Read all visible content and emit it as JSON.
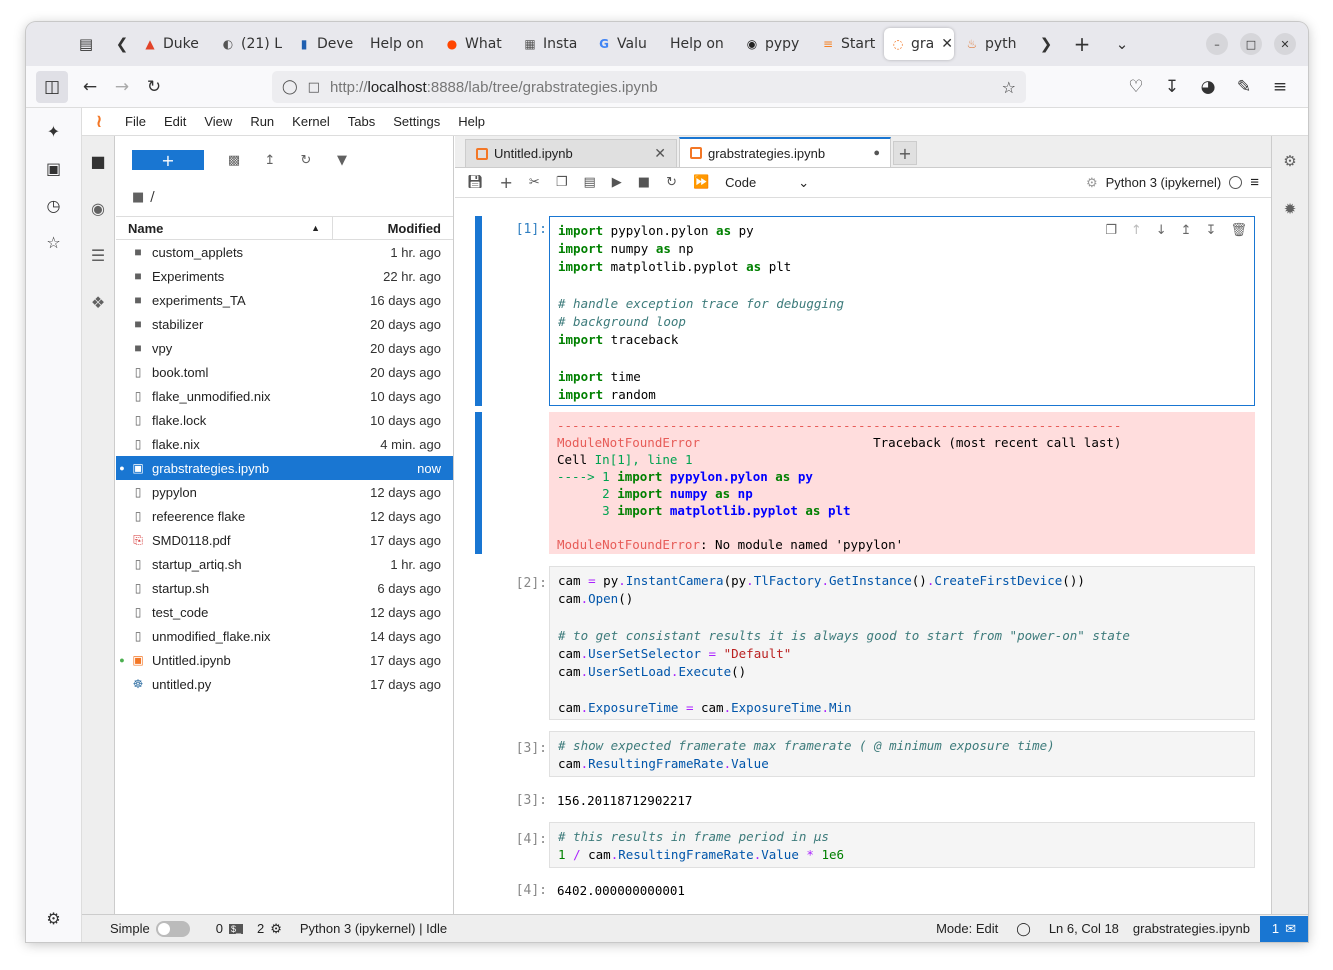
{
  "browser": {
    "tabs": [
      {
        "label": "Duke",
        "icon": "gitlab-icon",
        "color": "#e24329"
      },
      {
        "label": "(21) L",
        "icon": "chat-icon",
        "color": "#555555"
      },
      {
        "label": "Deve",
        "icon": "dev-icon",
        "color": "#1f5fb0"
      },
      {
        "label": "Help on",
        "icon": "",
        "color": ""
      },
      {
        "label": "What",
        "icon": "reddit-icon",
        "color": "#ff4500"
      },
      {
        "label": "Insta",
        "icon": "grid-icon",
        "color": "#555555"
      },
      {
        "label": "Valu",
        "icon": "google-icon",
        "color": "#4285f4"
      },
      {
        "label": "Help on",
        "icon": "",
        "color": ""
      },
      {
        "label": "pypy",
        "icon": "github-icon",
        "color": "#222222"
      },
      {
        "label": "Start",
        "icon": "stack-icon",
        "color": "#f48024"
      },
      {
        "label": "gra",
        "icon": "jupyter-icon",
        "color": "#f37726",
        "active": true
      },
      {
        "label": "pyth",
        "icon": "python-icon",
        "color": "#e07b39"
      }
    ],
    "url_prefix": "http://",
    "url_host": "localhost",
    "url_rest": ":8888/lab/tree/grabstrategies.ipynb"
  },
  "menu": [
    "File",
    "Edit",
    "View",
    "Run",
    "Kernel",
    "Tabs",
    "Settings",
    "Help"
  ],
  "filebrowser": {
    "new_label": "+",
    "path": "/",
    "col_name": "Name",
    "col_modified": "Modified",
    "files": [
      {
        "name": "custom_applets",
        "modified": "1 hr. ago",
        "type": "folder"
      },
      {
        "name": "Experiments",
        "modified": "22 hr. ago",
        "type": "folder"
      },
      {
        "name": "experiments_TA",
        "modified": "16 days ago",
        "type": "folder"
      },
      {
        "name": "stabilizer",
        "modified": "20 days ago",
        "type": "folder"
      },
      {
        "name": "vpy",
        "modified": "20 days ago",
        "type": "folder"
      },
      {
        "name": "book.toml",
        "modified": "20 days ago",
        "type": "file"
      },
      {
        "name": "flake_unmodified.nix",
        "modified": "10 days ago",
        "type": "file"
      },
      {
        "name": "flake.lock",
        "modified": "10 days ago",
        "type": "file"
      },
      {
        "name": "flake.nix",
        "modified": "4 min. ago",
        "type": "file"
      },
      {
        "name": "grabstrategies.ipynb",
        "modified": "now",
        "type": "notebook",
        "selected": true,
        "running": true
      },
      {
        "name": "pypylon",
        "modified": "12 days ago",
        "type": "file"
      },
      {
        "name": "refeerence flake",
        "modified": "12 days ago",
        "type": "file"
      },
      {
        "name": "SMD0118.pdf",
        "modified": "17 days ago",
        "type": "pdf"
      },
      {
        "name": "startup_artiq.sh",
        "modified": "1 hr. ago",
        "type": "file"
      },
      {
        "name": "startup.sh",
        "modified": "6 days ago",
        "type": "file"
      },
      {
        "name": "test_code",
        "modified": "12 days ago",
        "type": "file"
      },
      {
        "name": "unmodified_flake.nix",
        "modified": "14 days ago",
        "type": "file"
      },
      {
        "name": "Untitled.ipynb",
        "modified": "17 days ago",
        "type": "notebook",
        "running": true
      },
      {
        "name": "untitled.py",
        "modified": "17 days ago",
        "type": "python"
      }
    ]
  },
  "notebook_tabs": [
    {
      "label": "Untitled.ipynb",
      "active": false
    },
    {
      "label": "grabstrategies.ipynb",
      "active": true
    }
  ],
  "toolbar": {
    "cell_type": "Code",
    "kernel": "Python 3 (ipykernel)"
  },
  "cells": {
    "c1_prompt": "[1]:",
    "c2_prompt": "[2]:",
    "c3_prompt": "[3]:",
    "c3_out_prompt": "[3]:",
    "c3_output": "156.20118712902217",
    "c4_prompt": "[4]:",
    "c4_out_prompt": "[4]:",
    "c4_output": "6402.000000000001"
  },
  "statusbar": {
    "mode_label": "Simple",
    "terminals": "0",
    "kernels": "2",
    "kernel_status": "Python 3 (ipykernel) | Idle",
    "edit_mode": "Mode: Edit",
    "cursor": "Ln 6, Col 18",
    "filename": "grabstrategies.ipynb",
    "notifications": "1"
  }
}
